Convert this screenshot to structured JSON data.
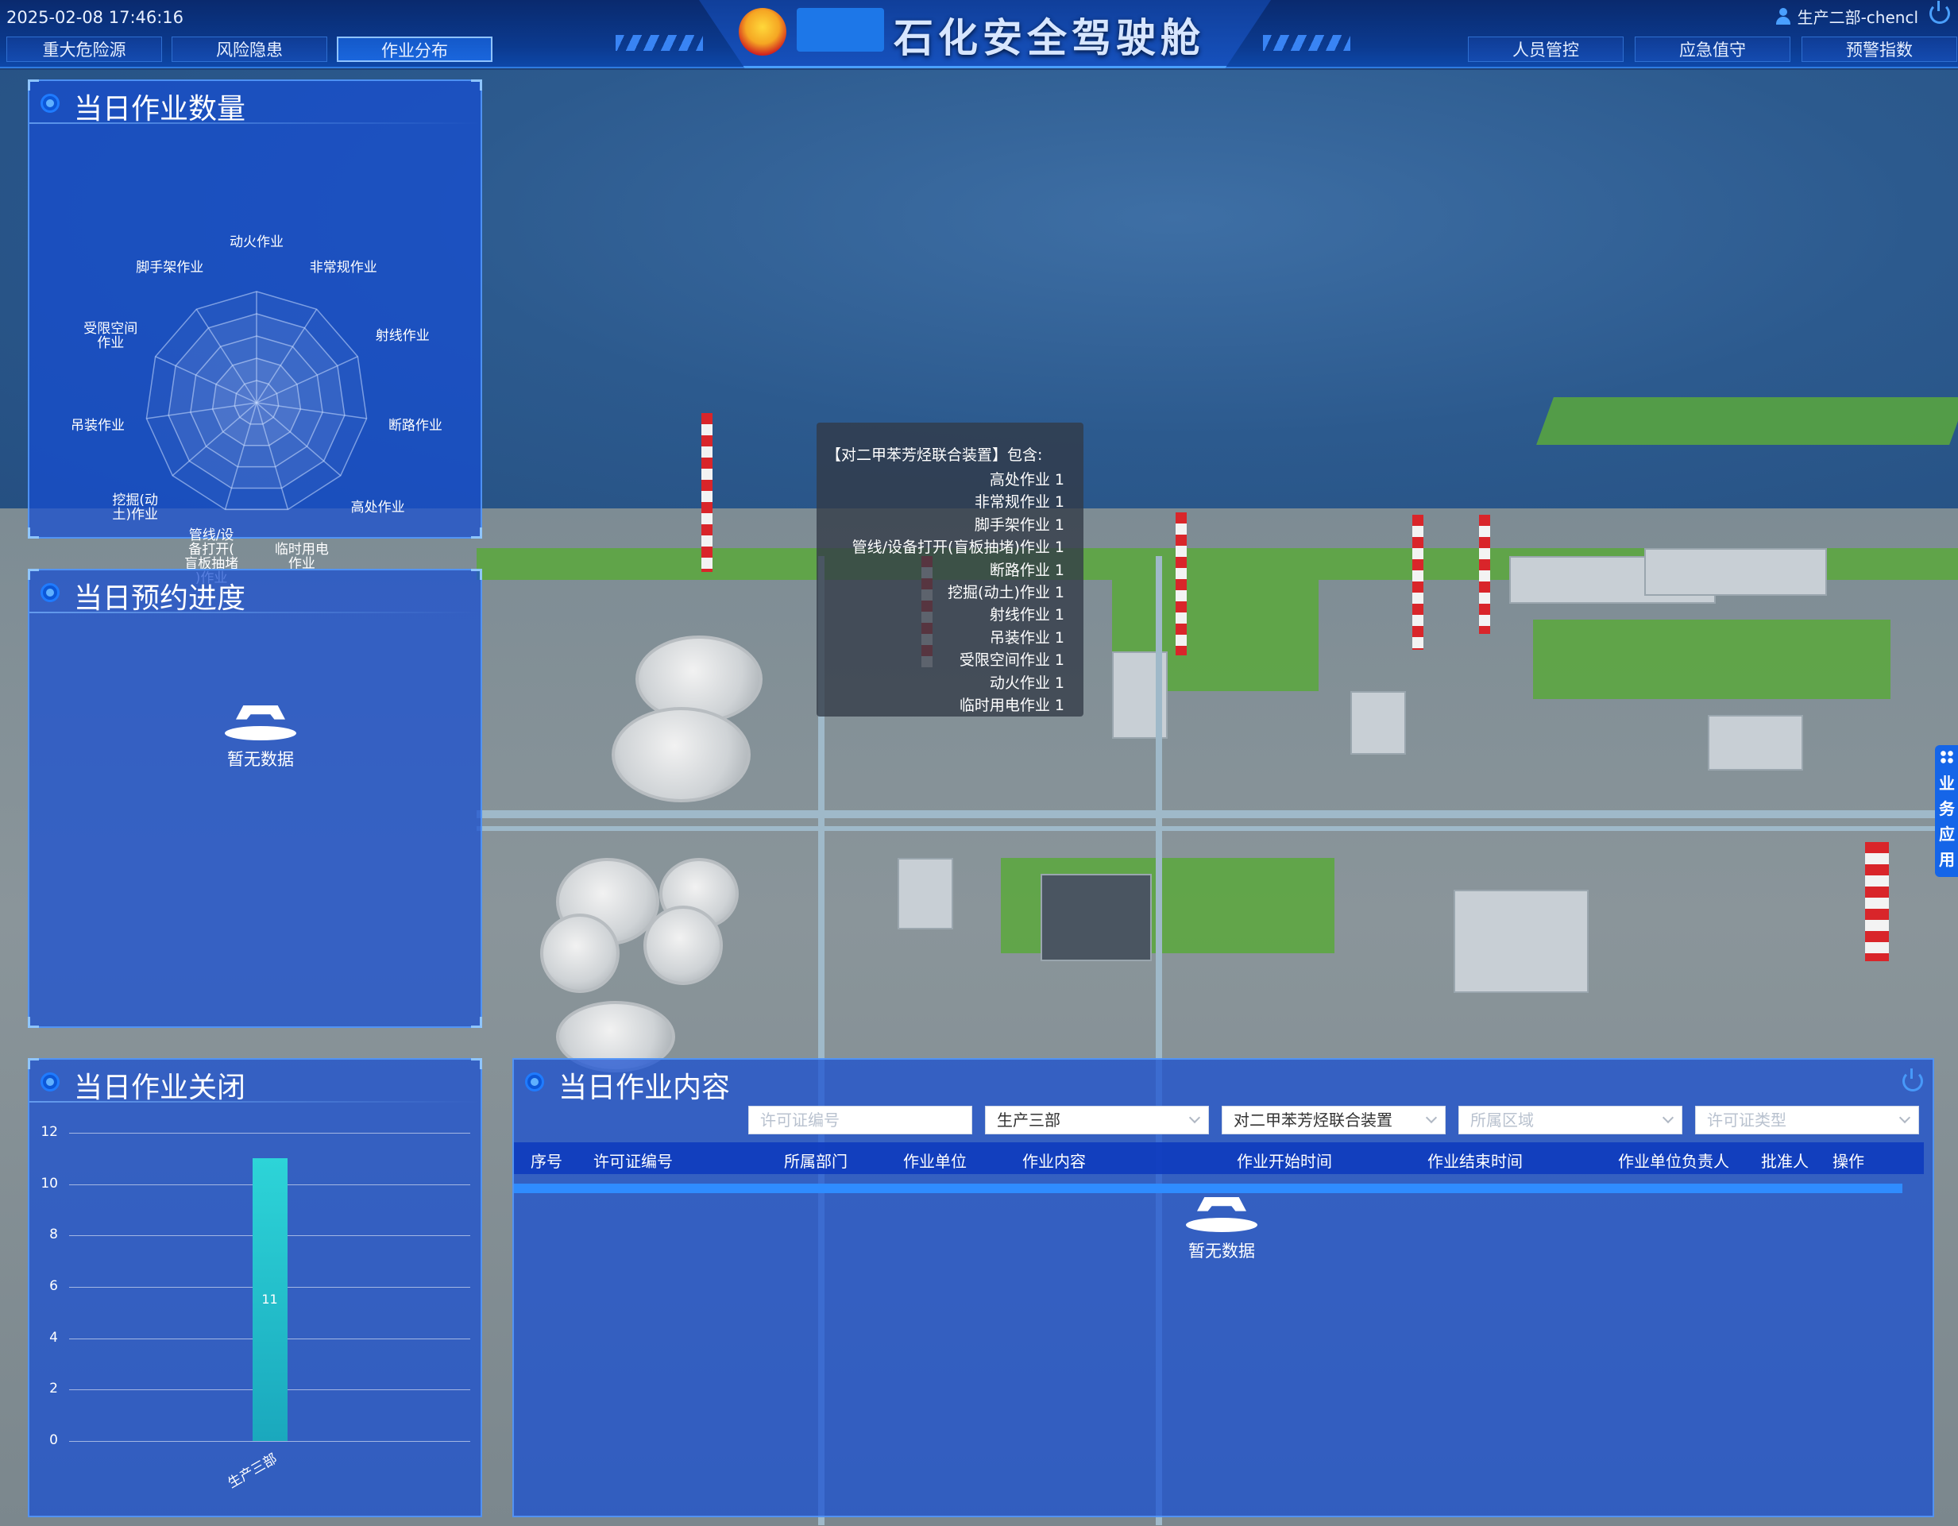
{
  "header": {
    "datetime": "2025-02-08 17:46:16",
    "title": "石化安全驾驶舱",
    "user": "生产二部-chencl",
    "nav_left": [
      "重大危险源",
      "风险隐患",
      "作业分布"
    ],
    "nav_right": [
      "人员管控",
      "应急值守",
      "预警指数"
    ],
    "active_nav": "作业分布",
    "colors": {
      "header_bg": "#0b3a8f",
      "accent": "#4aa0ff"
    }
  },
  "panels": {
    "work_count": {
      "title": "当日作业数量",
      "radar_labels": [
        "动火作业",
        "非常规作业",
        "射线作业",
        "断路作业",
        "高处作业",
        "临时用电\n作业",
        "管线/设\n备打开(\n盲板抽堵\n)作业",
        "挖掘(动\n土)作业",
        "吊装作业",
        "受限空间\n作业",
        "脚手架作业"
      ]
    },
    "reservation": {
      "title": "当日预约进度",
      "empty_text": "暂无数据"
    },
    "closed": {
      "title": "当日作业关闭"
    },
    "content": {
      "title": "当日作业内容",
      "filters": {
        "permit_no": {
          "placeholder": "许可证编号",
          "value": ""
        },
        "department": {
          "value": "生产三部"
        },
        "unit": {
          "value": "对二甲苯芳烃联合装置"
        },
        "area": {
          "placeholder": "所属区域",
          "value": ""
        },
        "permit_type": {
          "placeholder": "许可证类型",
          "value": ""
        }
      },
      "columns": [
        "序号",
        "许可证编号",
        "所属部门",
        "作业单位",
        "作业内容",
        "作业开始时间",
        "作业结束时间",
        "作业单位负责人",
        "批准人",
        "操作"
      ],
      "empty_text": "暂无数据"
    }
  },
  "chart_data": [
    {
      "type": "radar",
      "title": "当日作业数量",
      "indicators": [
        "动火作业",
        "非常规作业",
        "射线作业",
        "断路作业",
        "高处作业",
        "临时用电作业",
        "管线/设备打开(盲板抽堵)作业",
        "挖掘(动土)作业",
        "吊装作业",
        "受限空间作业",
        "脚手架作业"
      ],
      "values": []
    },
    {
      "type": "bar",
      "title": "当日作业关闭",
      "categories": [
        "生产三部"
      ],
      "values": [
        11
      ],
      "ylim": [
        0,
        12
      ],
      "yticks": [
        0,
        2,
        4,
        6,
        8,
        10,
        12
      ],
      "grid": true,
      "bar_color": "#2dd4d8"
    }
  ],
  "tooltip": {
    "header": "【对二甲苯芳烃联合装置】包含:",
    "rows": [
      "高处作业 1",
      "非常规作业 1",
      "脚手架作业 1",
      "管线/设备打开(盲板抽堵)作业 1",
      "断路作业 1",
      "挖掘(动土)作业 1",
      "射线作业 1",
      "吊装作业 1",
      "受限空间作业 1",
      "动火作业 1",
      "临时用电作业 1"
    ]
  },
  "side_tab": {
    "label": "业务应用"
  }
}
